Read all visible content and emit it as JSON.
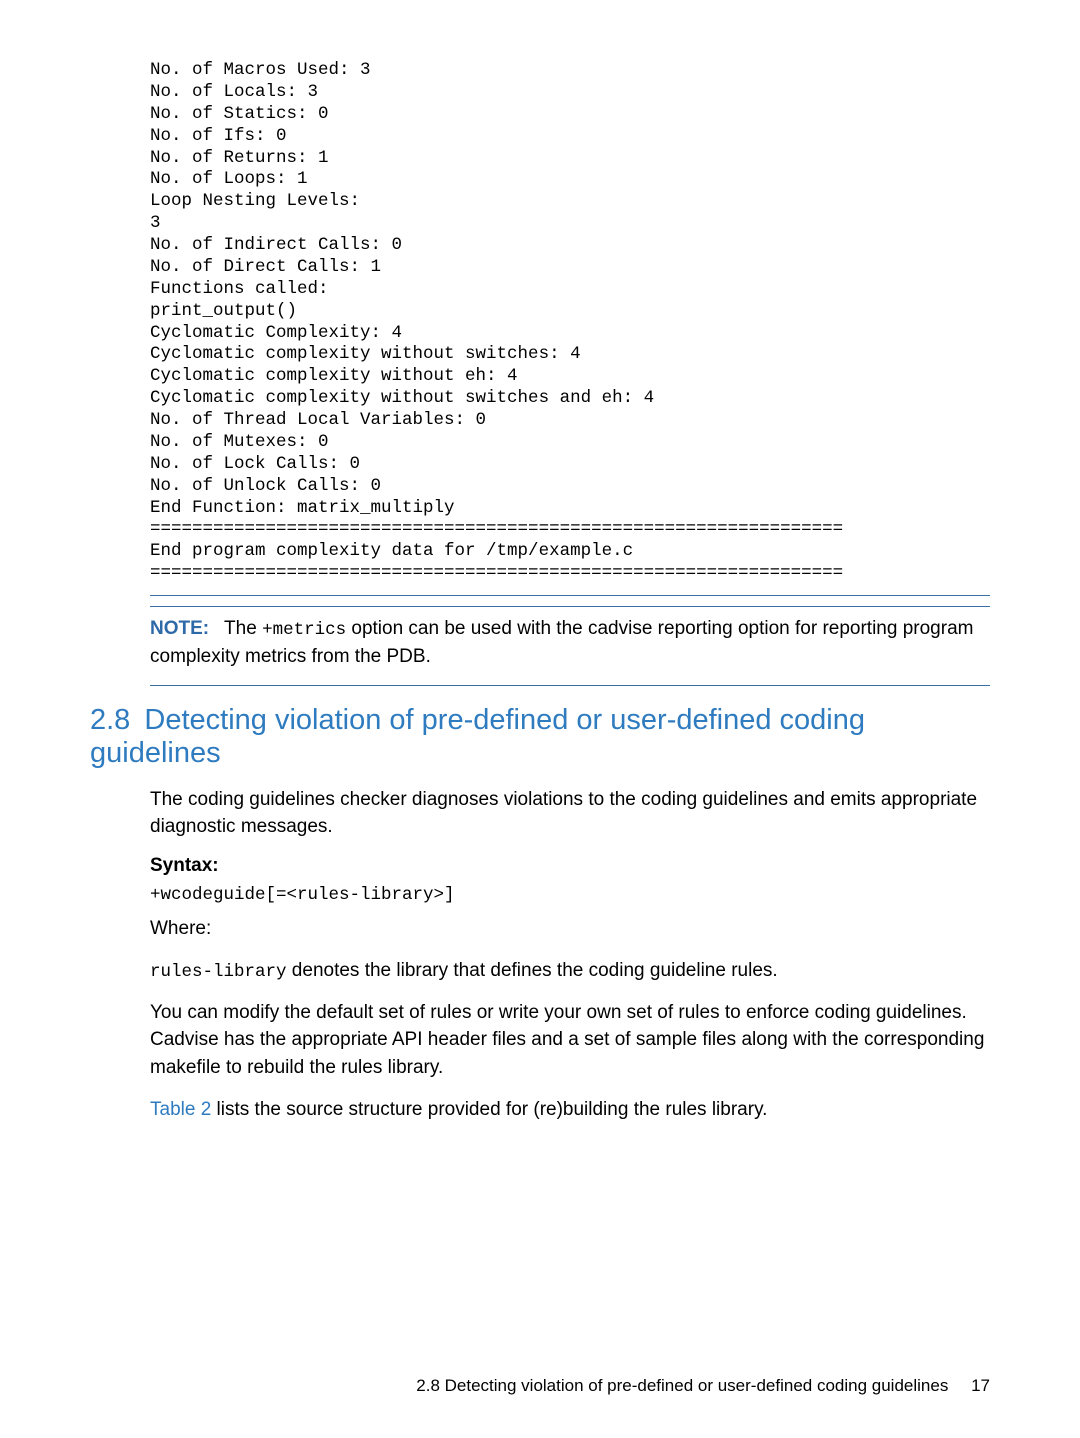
{
  "code_listing": "No. of Macros Used: 3\nNo. of Locals: 3\nNo. of Statics: 0\nNo. of Ifs: 0\nNo. of Returns: 1\nNo. of Loops: 1\nLoop Nesting Levels:\n3\nNo. of Indirect Calls: 0\nNo. of Direct Calls: 1\nFunctions called:\nprint_output()\nCyclomatic Complexity: 4\nCyclomatic complexity without switches: 4\nCyclomatic complexity without eh: 4\nCyclomatic complexity without switches and eh: 4\nNo. of Thread Local Variables: 0\nNo. of Mutexes: 0\nNo. of Lock Calls: 0\nNo. of Unlock Calls: 0\nEnd Function: matrix_multiply\n==================================================================\nEnd program complexity data for /tmp/example.c\n==================================================================",
  "note": {
    "label": "NOTE:",
    "pre": "The ",
    "code": "+metrics",
    "post": " option can be used with the cadvise reporting option for reporting program complexity metrics from the PDB."
  },
  "section": {
    "number": "2.8",
    "title": "Detecting violation of pre-defined or user-defined coding guidelines",
    "intro": "The coding guidelines checker diagnoses violations to the coding guidelines and emits appropriate diagnostic messages.",
    "syntax_label": "Syntax:",
    "syntax_code": "+wcodeguide[=<rules-library>]",
    "where_label": "Where:",
    "rules_lib_code": "rules-library",
    "rules_lib_post": " denotes the library that defines the coding guideline rules.",
    "para_modify": "You can modify the default set of rules or write your own set of rules to enforce coding guidelines. Cadvise has the appropriate API header files and a set of sample files along with the corresponding makefile to rebuild the rules library.",
    "table_link": "Table 2",
    "table_post": " lists the source structure provided for (re)building the rules library."
  },
  "footer": {
    "text": "2.8 Detecting violation of pre-defined or user-defined coding guidelines",
    "page": "17"
  }
}
